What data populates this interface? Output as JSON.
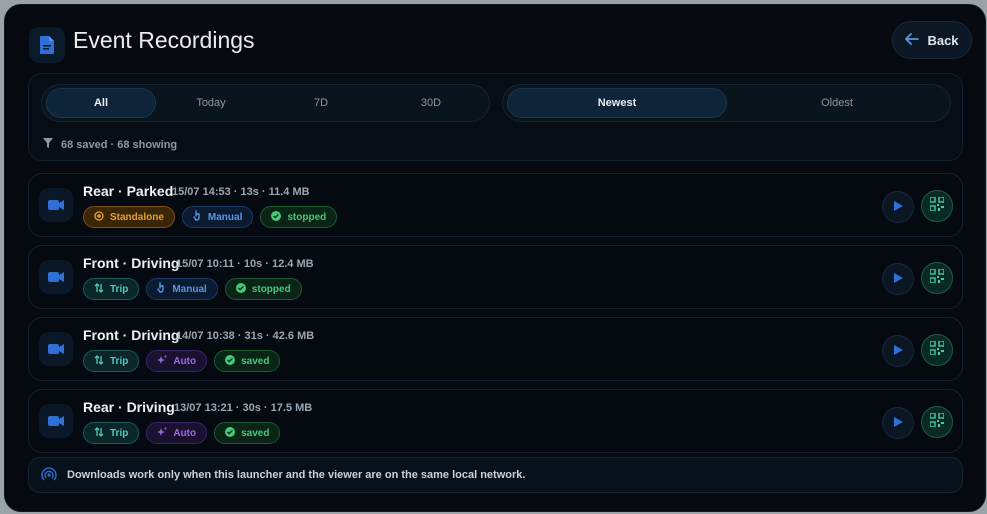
{
  "header": {
    "title": "Event Recordings",
    "back_label": "Back"
  },
  "filters": {
    "range_options": [
      "All",
      "Today",
      "7D",
      "30D"
    ],
    "range_selected": "All",
    "sort_options": [
      "Newest",
      "Oldest"
    ],
    "sort_selected": "Newest",
    "summary": "68 saved · 68 showing"
  },
  "recordings": [
    {
      "title": "Rear · Parked",
      "meta": "15/07 14:53 · 13s · 11.4 MB",
      "chips": [
        {
          "label": "Standalone",
          "kind": "standalone",
          "icon": "target-icon"
        },
        {
          "label": "Manual",
          "kind": "manual",
          "icon": "hand-icon"
        },
        {
          "label": "stopped",
          "kind": "stopped",
          "icon": "check-circle-icon"
        }
      ]
    },
    {
      "title": "Front · Driving",
      "meta": "15/07 10:11 · 10s · 12.4 MB",
      "chips": [
        {
          "label": "Trip",
          "kind": "trip",
          "icon": "swap-icon"
        },
        {
          "label": "Manual",
          "kind": "manual",
          "icon": "hand-icon"
        },
        {
          "label": "stopped",
          "kind": "stopped",
          "icon": "check-circle-icon"
        }
      ]
    },
    {
      "title": "Front · Driving",
      "meta": "14/07 10:38 · 31s · 42.6 MB",
      "chips": [
        {
          "label": "Trip",
          "kind": "trip",
          "icon": "swap-icon"
        },
        {
          "label": "Auto",
          "kind": "auto",
          "icon": "sparkle-icon"
        },
        {
          "label": "saved",
          "kind": "saved",
          "icon": "check-circle-icon"
        }
      ]
    },
    {
      "title": "Rear · Driving",
      "meta": "13/07 13:21 · 30s · 17.5 MB",
      "chips": [
        {
          "label": "Trip",
          "kind": "trip",
          "icon": "swap-icon"
        },
        {
          "label": "Auto",
          "kind": "auto",
          "icon": "sparkle-icon"
        },
        {
          "label": "saved",
          "kind": "saved",
          "icon": "check-circle-icon"
        }
      ]
    }
  ],
  "notice": "Downloads work only when this launcher and the viewer are on the same local network.",
  "colors": {
    "background": "#060a10",
    "accent": "#5b96e6",
    "standalone": "#e0a030",
    "success": "#45c878",
    "trip": "#52c9c0",
    "auto": "#9a6ae0"
  }
}
